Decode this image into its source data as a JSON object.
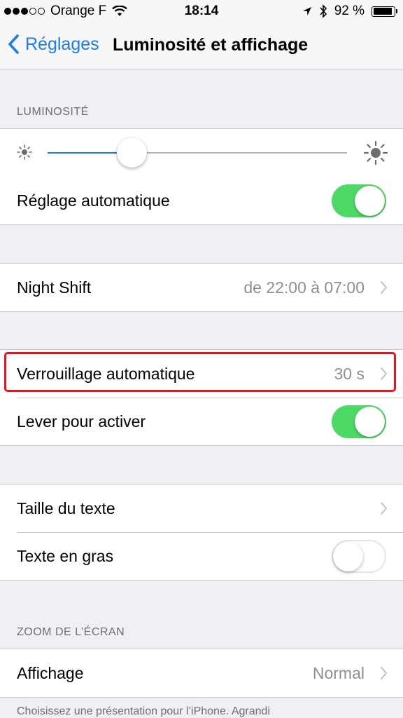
{
  "status_bar": {
    "signal_bars_filled": 3,
    "signal_bars_total": 5,
    "carrier": "Orange F",
    "time": "18:14",
    "battery_percent": "92 %",
    "battery_level": 0.92
  },
  "nav": {
    "back_label": "Réglages",
    "title": "Luminosité et affichage"
  },
  "brightness": {
    "section_header": "LUMINOSITÉ",
    "level": 0.28,
    "auto_label": "Réglage automatique",
    "auto_on": true
  },
  "night_shift": {
    "label": "Night Shift",
    "value": "de 22:00 à 07:00"
  },
  "lock": {
    "auto_lock_label": "Verrouillage automatique",
    "auto_lock_value": "30 s",
    "raise_label": "Lever pour activer",
    "raise_on": true
  },
  "text": {
    "size_label": "Taille du texte",
    "bold_label": "Texte en gras",
    "bold_on": false
  },
  "zoom": {
    "section_header": "ZOOM DE L’ÉCRAN",
    "display_label": "Affichage",
    "display_value": "Normal",
    "footer": "Choisissez une présentation pour l’iPhone. Agrandi"
  },
  "colors": {
    "accent": "#1a7cf5",
    "toggle_on": "#4cd964",
    "highlight": "#e8131b"
  }
}
